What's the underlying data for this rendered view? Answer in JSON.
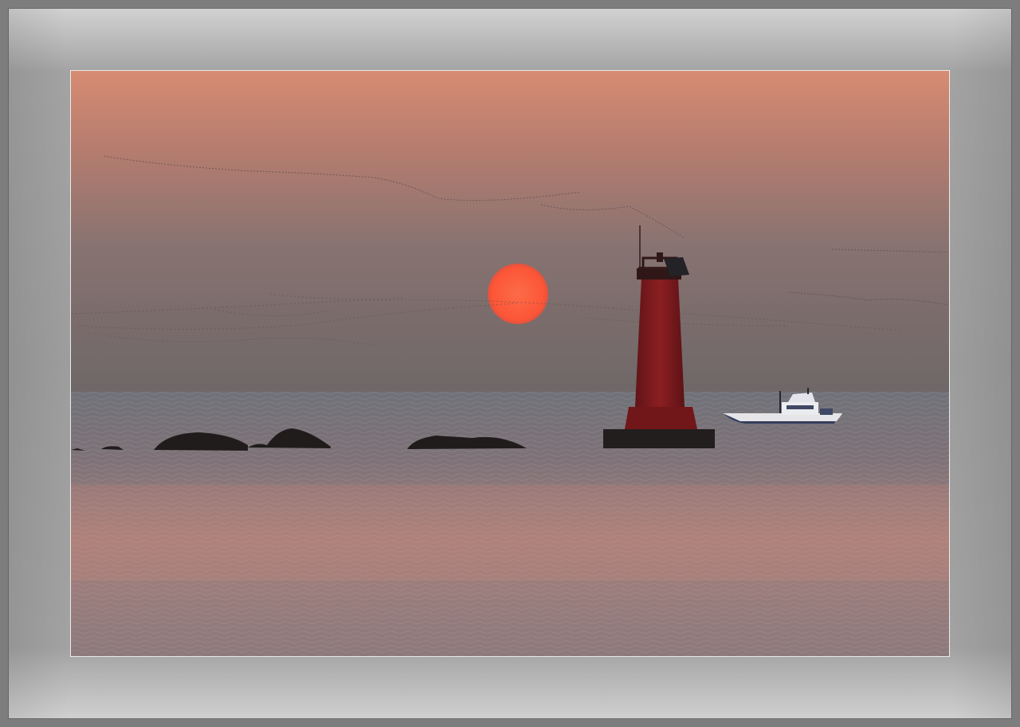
{
  "image": {
    "subject": "sunset-seascape-with-lighthouse",
    "colors": {
      "frame": "#9d9d9d",
      "sky_top": "#d98c72",
      "sky_bottom": "#6d6462",
      "sun": "#ff5a3a",
      "lighthouse": "#7a1518",
      "sea": "#8a7c7c",
      "rocks": "#1b1716"
    }
  }
}
